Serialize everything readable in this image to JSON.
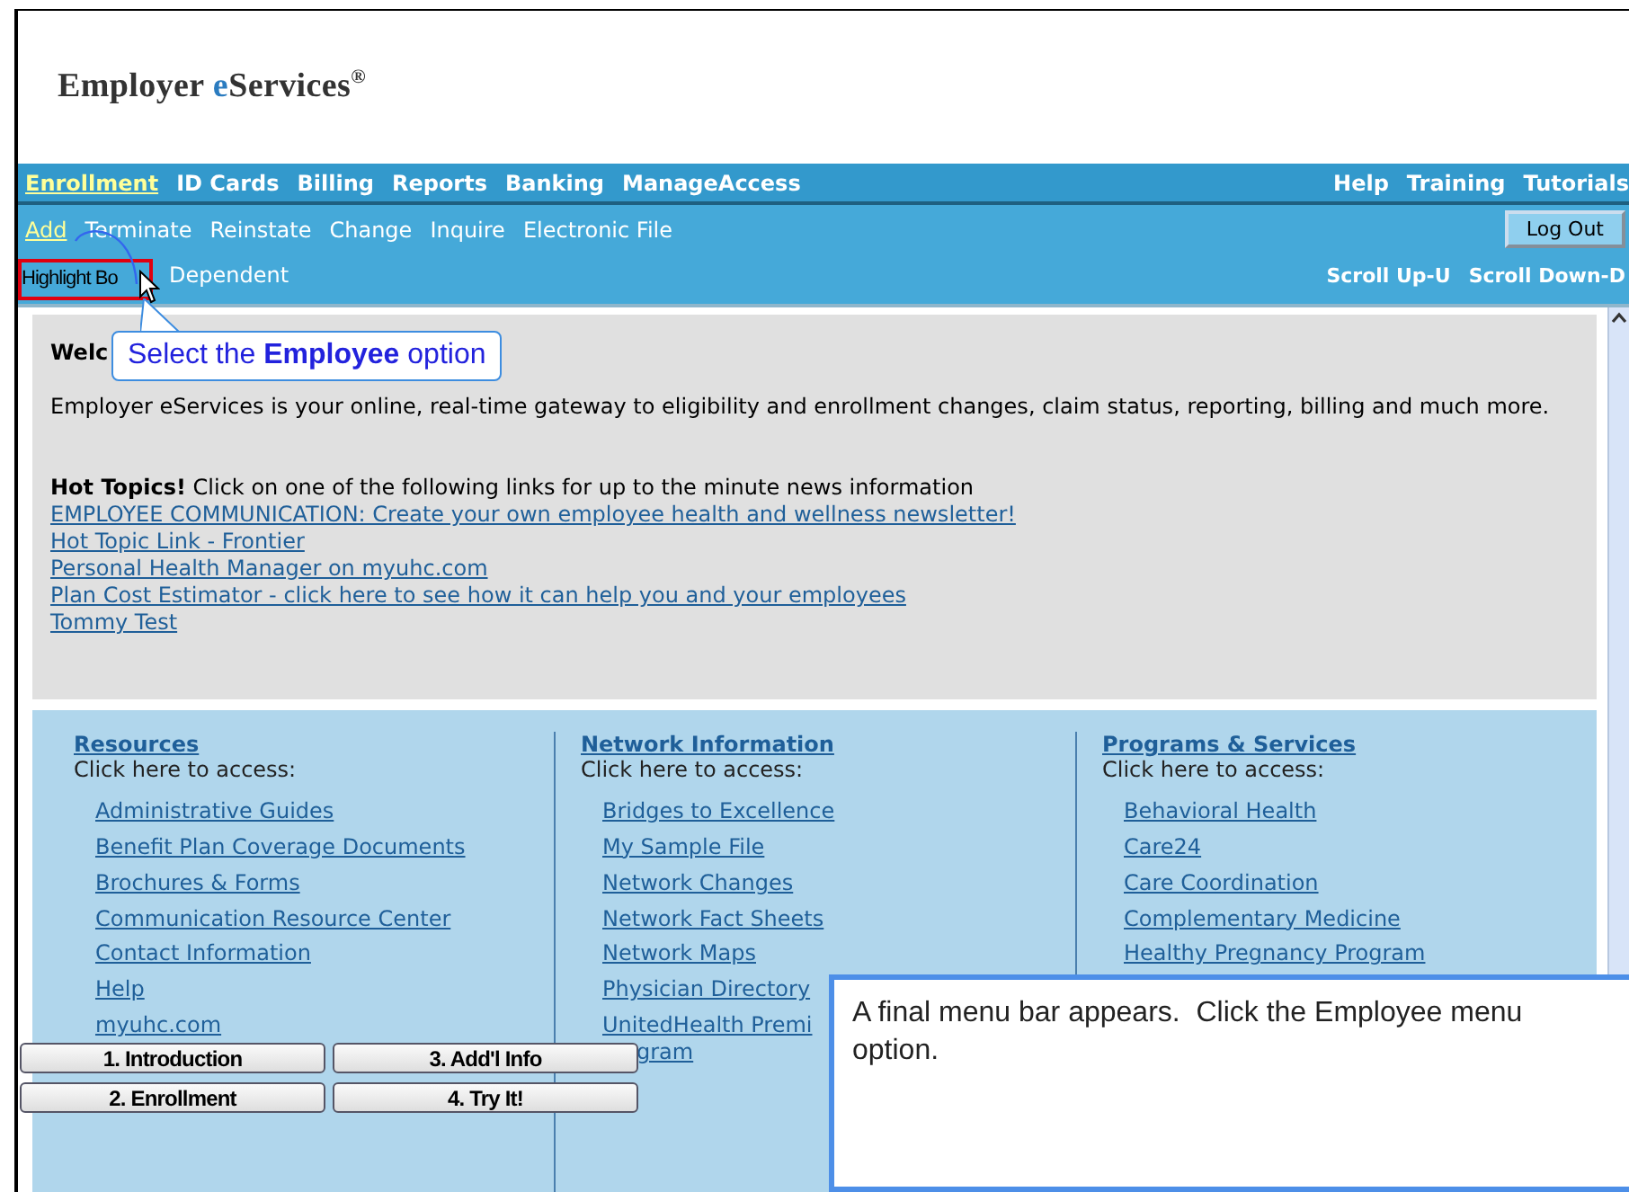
{
  "logo": {
    "prefix": "Employer ",
    "accent": "e",
    "suffix": "Services",
    "mark": "®"
  },
  "nav": {
    "items": [
      {
        "label": "Enrollment",
        "selected": true
      },
      {
        "label": "ID Cards",
        "selected": false
      },
      {
        "label": "Billing",
        "selected": false
      },
      {
        "label": "Reports",
        "selected": false
      },
      {
        "label": "Banking",
        "selected": false
      },
      {
        "label": "ManageAccess",
        "selected": false
      }
    ],
    "right": [
      "Help",
      "Training",
      "Tutorials"
    ]
  },
  "subnav": {
    "items": [
      {
        "label": "Add",
        "selected": true
      },
      {
        "label": "Terminate",
        "selected": false
      },
      {
        "label": "Reinstate",
        "selected": false
      },
      {
        "label": "Change",
        "selected": false
      },
      {
        "label": "Inquire",
        "selected": false
      },
      {
        "label": "Electronic File",
        "selected": false
      }
    ],
    "logout": "Log Out",
    "third_row": [
      "Dependent"
    ],
    "scroll": [
      "Scroll Up-U",
      "Scroll Down-D"
    ]
  },
  "welcome": {
    "heading": "Welc",
    "body": "Employer eServices is your online, real-time gateway to eligibility and enrollment changes, claim status, reporting, billing and much more.",
    "hot_topics": "**Hot Topics!** Click on one of the following links for up to the minute news information",
    "links": [
      "EMPLOYEE COMMUNICATION: Create your own employee health and wellness newsletter!",
      "Hot Topic Link - Frontier",
      "Personal Health Manager on myuhc.com",
      "Plan Cost Estimator - click here to see how it can help you and your employees",
      "Tommy Test"
    ]
  },
  "columns": [
    {
      "title": "Resources",
      "caption": "Click here to access:",
      "items": [
        {
          "lines": [
            "Administrative Guides"
          ]
        },
        {
          "lines": [
            "Benefit Plan Coverage Documents"
          ]
        },
        {
          "lines": [
            "Brochures & Forms"
          ]
        },
        {
          "lines": [
            "Communication Resource Center"
          ]
        },
        {
          "lines": [
            "Contact Information"
          ]
        },
        {
          "lines": [
            "Help"
          ]
        },
        {
          "lines": [
            "myuhc.com"
          ]
        }
      ]
    },
    {
      "title": "Network Information",
      "caption": "Click here to access:",
      "items": [
        {
          "lines": [
            "Bridges to Excellence"
          ]
        },
        {
          "lines": [
            "My Sample File"
          ]
        },
        {
          "lines": [
            "Network Changes"
          ]
        },
        {
          "lines": [
            "Network Fact Sheets"
          ]
        },
        {
          "lines": [
            "Network Maps"
          ]
        },
        {
          "lines": [
            "Physician Directory"
          ]
        },
        {
          "lines": [
            "UnitedHealth Premi",
            "gram"
          ]
        }
      ]
    },
    {
      "title": "Programs & Services",
      "caption": "Click here to access:",
      "items": [
        {
          "lines": [
            "Behavioral Health"
          ]
        },
        {
          "lines": [
            "Care24"
          ]
        },
        {
          "lines": [
            "Care Coordination"
          ]
        },
        {
          "lines": [
            "Complementary Medicine"
          ]
        },
        {
          "lines": [
            "Healthy Pregnancy Program"
          ]
        }
      ]
    }
  ],
  "tutorial": {
    "highlight_label": "Highlight Bo",
    "callout": "Select the **Employee** option",
    "instruction": "A final menu bar appears.  Click the Employee menu option.",
    "steps": [
      {
        "label": "1. Introduction"
      },
      {
        "label": "3. Add'l Info"
      },
      {
        "label": "2. Enrollment"
      },
      {
        "label": "4. Try It!"
      }
    ]
  }
}
